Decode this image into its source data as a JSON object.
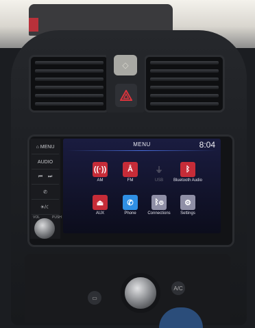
{
  "head_unit": {
    "side_buttons": {
      "menu": "MENU",
      "audio": "AUDIO",
      "vol": "VOL",
      "push": "PUSH"
    },
    "screen": {
      "title": "MENU",
      "clock": "8:04",
      "apps": [
        {
          "label": "AM",
          "icon": "am-radio-icon",
          "color": "#c62c38",
          "enabled": true
        },
        {
          "label": "FM",
          "icon": "fm-radio-icon",
          "color": "#c62c38",
          "enabled": true
        },
        {
          "label": "USB",
          "icon": "usb-icon",
          "color": "#00000000",
          "enabled": false
        },
        {
          "label": "Bluetooth Audio",
          "icon": "bluetooth-icon",
          "color": "#c62c38",
          "enabled": true
        },
        {
          "label": "AUX",
          "icon": "aux-icon",
          "color": "#c62c38",
          "enabled": true
        },
        {
          "label": "Phone",
          "icon": "phone-icon",
          "color": "#2f8fe4",
          "enabled": true
        },
        {
          "label": "Connections",
          "icon": "connections-icon",
          "color": "#8f8fa6",
          "enabled": true
        },
        {
          "label": "Settings",
          "icon": "settings-icon",
          "color": "#8f8fa6",
          "enabled": true
        }
      ]
    }
  }
}
